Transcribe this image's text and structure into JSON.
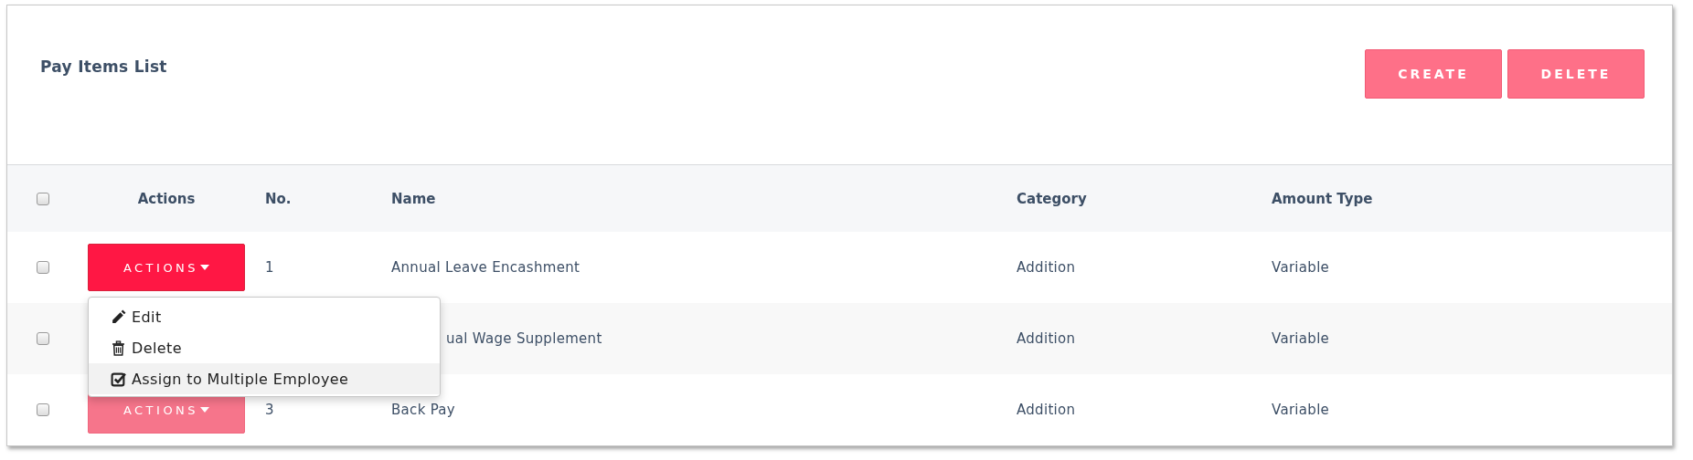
{
  "title": "Pay Items List",
  "buttons": [
    {
      "label": "CREATE"
    },
    {
      "label": "DELETE"
    }
  ],
  "table": {
    "select_all": {
      "checked": false
    },
    "columns": [
      "Actions",
      "No.",
      "Name",
      "Category",
      "Amount Type"
    ],
    "rows": [
      {
        "checked": false,
        "action": {
          "label": "ACTIONS",
          "open": true
        },
        "no": "1",
        "name": "Annual Leave Encashment",
        "category": "Addition",
        "amount_type": "Variable"
      },
      {
        "checked": false,
        "name": "ual Wage Supplement",
        "category": "Addition",
        "amount_type": "Variable"
      },
      {
        "checked": false,
        "action": {
          "label": "ACTIONS",
          "open": false
        },
        "no": "3",
        "name": "Back Pay",
        "category": "Addition",
        "amount_type": "Variable"
      }
    ]
  },
  "menu": {
    "items": [
      {
        "kind": "edit",
        "label": "Edit",
        "selected": false
      },
      {
        "kind": "delete",
        "label": "Delete",
        "selected": false
      },
      {
        "kind": "assign",
        "label": "Assign to Multiple Employee",
        "selected": true
      }
    ]
  }
}
